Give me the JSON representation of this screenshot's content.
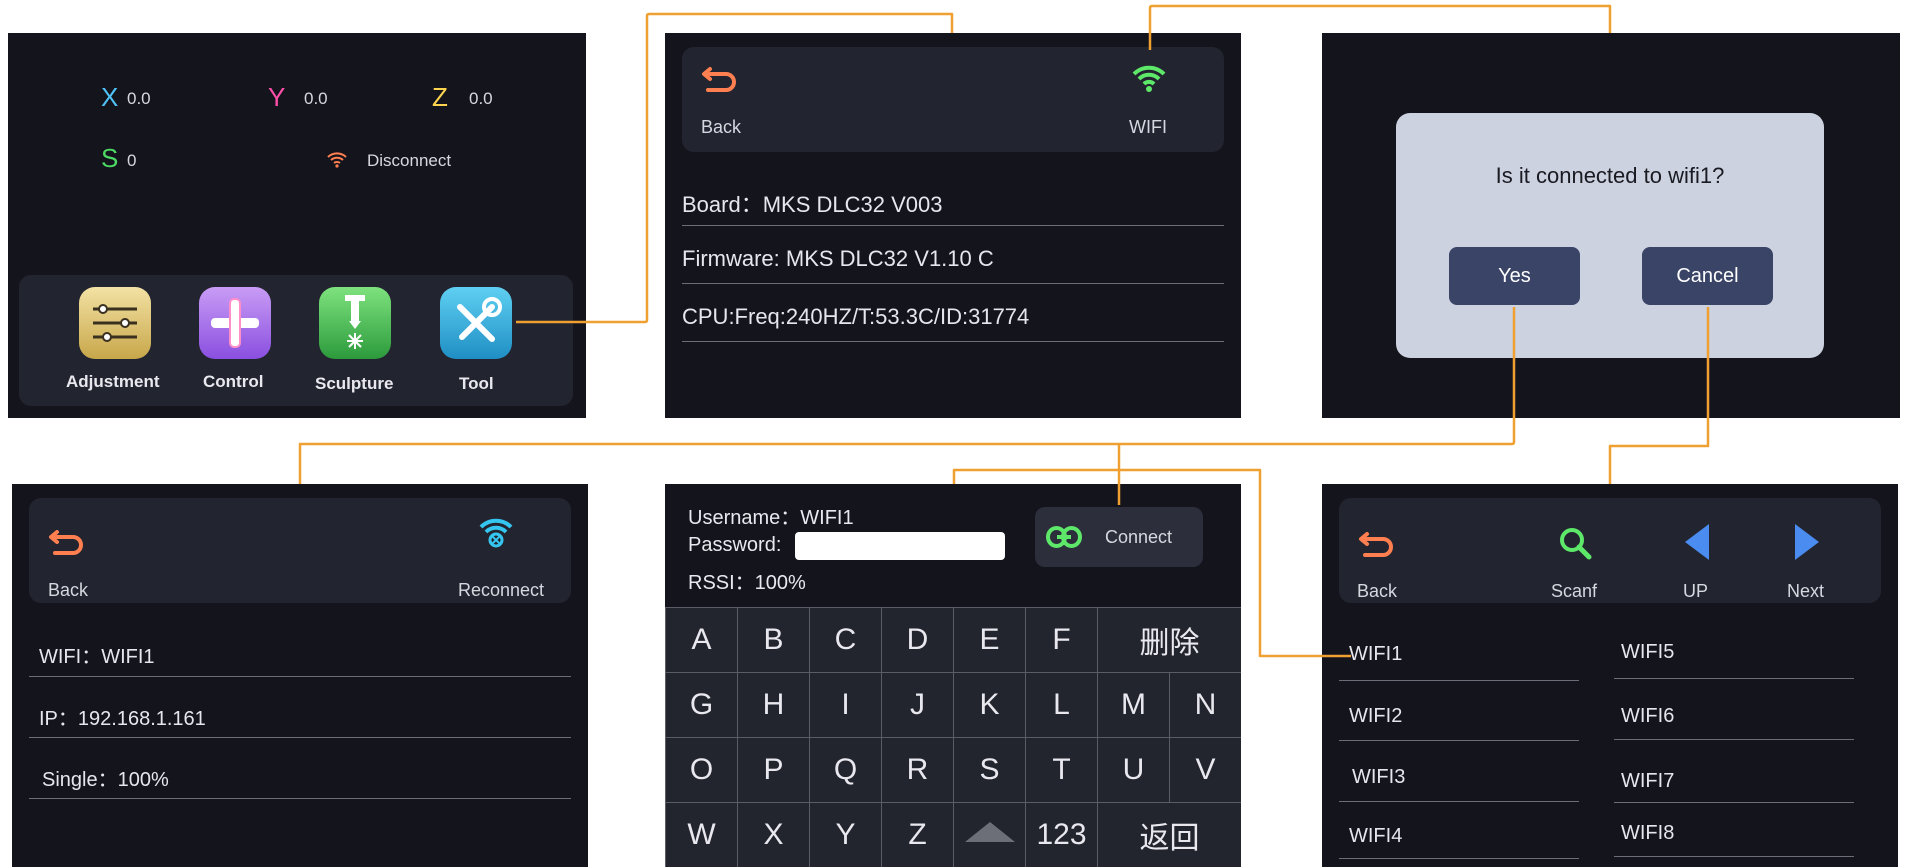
{
  "screen1": {
    "axes": [
      {
        "letter": "X",
        "value": "0.0",
        "color": "#4fc3f7"
      },
      {
        "letter": "Y",
        "value": "0.0",
        "color": "#ff4fa8"
      },
      {
        "letter": "Z",
        "value": "0.0",
        "color": "#ffd54f"
      },
      {
        "letter": "S",
        "value": "0",
        "color": "#4cd964"
      }
    ],
    "status": "Disconnect",
    "apps": [
      "Adjustment",
      "Control",
      "Sculpture",
      "Tool"
    ]
  },
  "screen2": {
    "back": "Back",
    "wifi": "WIFI",
    "rows": [
      "Board：MKS DLC32 V003",
      "Firmware: MKS DLC32 V1.10 C",
      "CPU:Freq:240HZ/T:53.3C/ID:31774"
    ]
  },
  "screen3": {
    "question": "Is it connected to wifi1?",
    "yes": "Yes",
    "cancel": "Cancel"
  },
  "screen4": {
    "back": "Back",
    "reconnect": "Reconnect",
    "rows": [
      "WIFI：WIFI1",
      "IP：192.168.1.161",
      "Single：100%"
    ]
  },
  "screen5": {
    "username": "Username：WIFI1",
    "password_label": "Password:",
    "password_value": "",
    "rssi": "RSSI：100%",
    "connect": "Connect",
    "keys_row1": [
      "A",
      "B",
      "C",
      "D",
      "E",
      "F",
      "删除"
    ],
    "keys_row2": [
      "G",
      "H",
      "I",
      "J",
      "K",
      "L",
      "M",
      "N"
    ],
    "keys_row3": [
      "O",
      "P",
      "Q",
      "R",
      "S",
      "T",
      "U",
      "V"
    ],
    "keys_row4": [
      "W",
      "X",
      "Y",
      "Z",
      "",
      "123",
      "返回"
    ]
  },
  "screen6": {
    "back": "Back",
    "scan": "Scanf",
    "up": "UP",
    "next": "Next",
    "left_list": [
      "WIFI1",
      "WIFI2",
      "WIFI3",
      "WIFI4"
    ],
    "right_list": [
      "WIFI5",
      "WIFI6",
      "WIFI7",
      "WIFI8"
    ]
  },
  "colors": {
    "accent_wire": "#f0a030",
    "back_icon": "#ff7f50",
    "wifi_green": "#5ee86a",
    "reconnect_cyan": "#34c6f0",
    "nav_blue": "#4a8cf0"
  }
}
